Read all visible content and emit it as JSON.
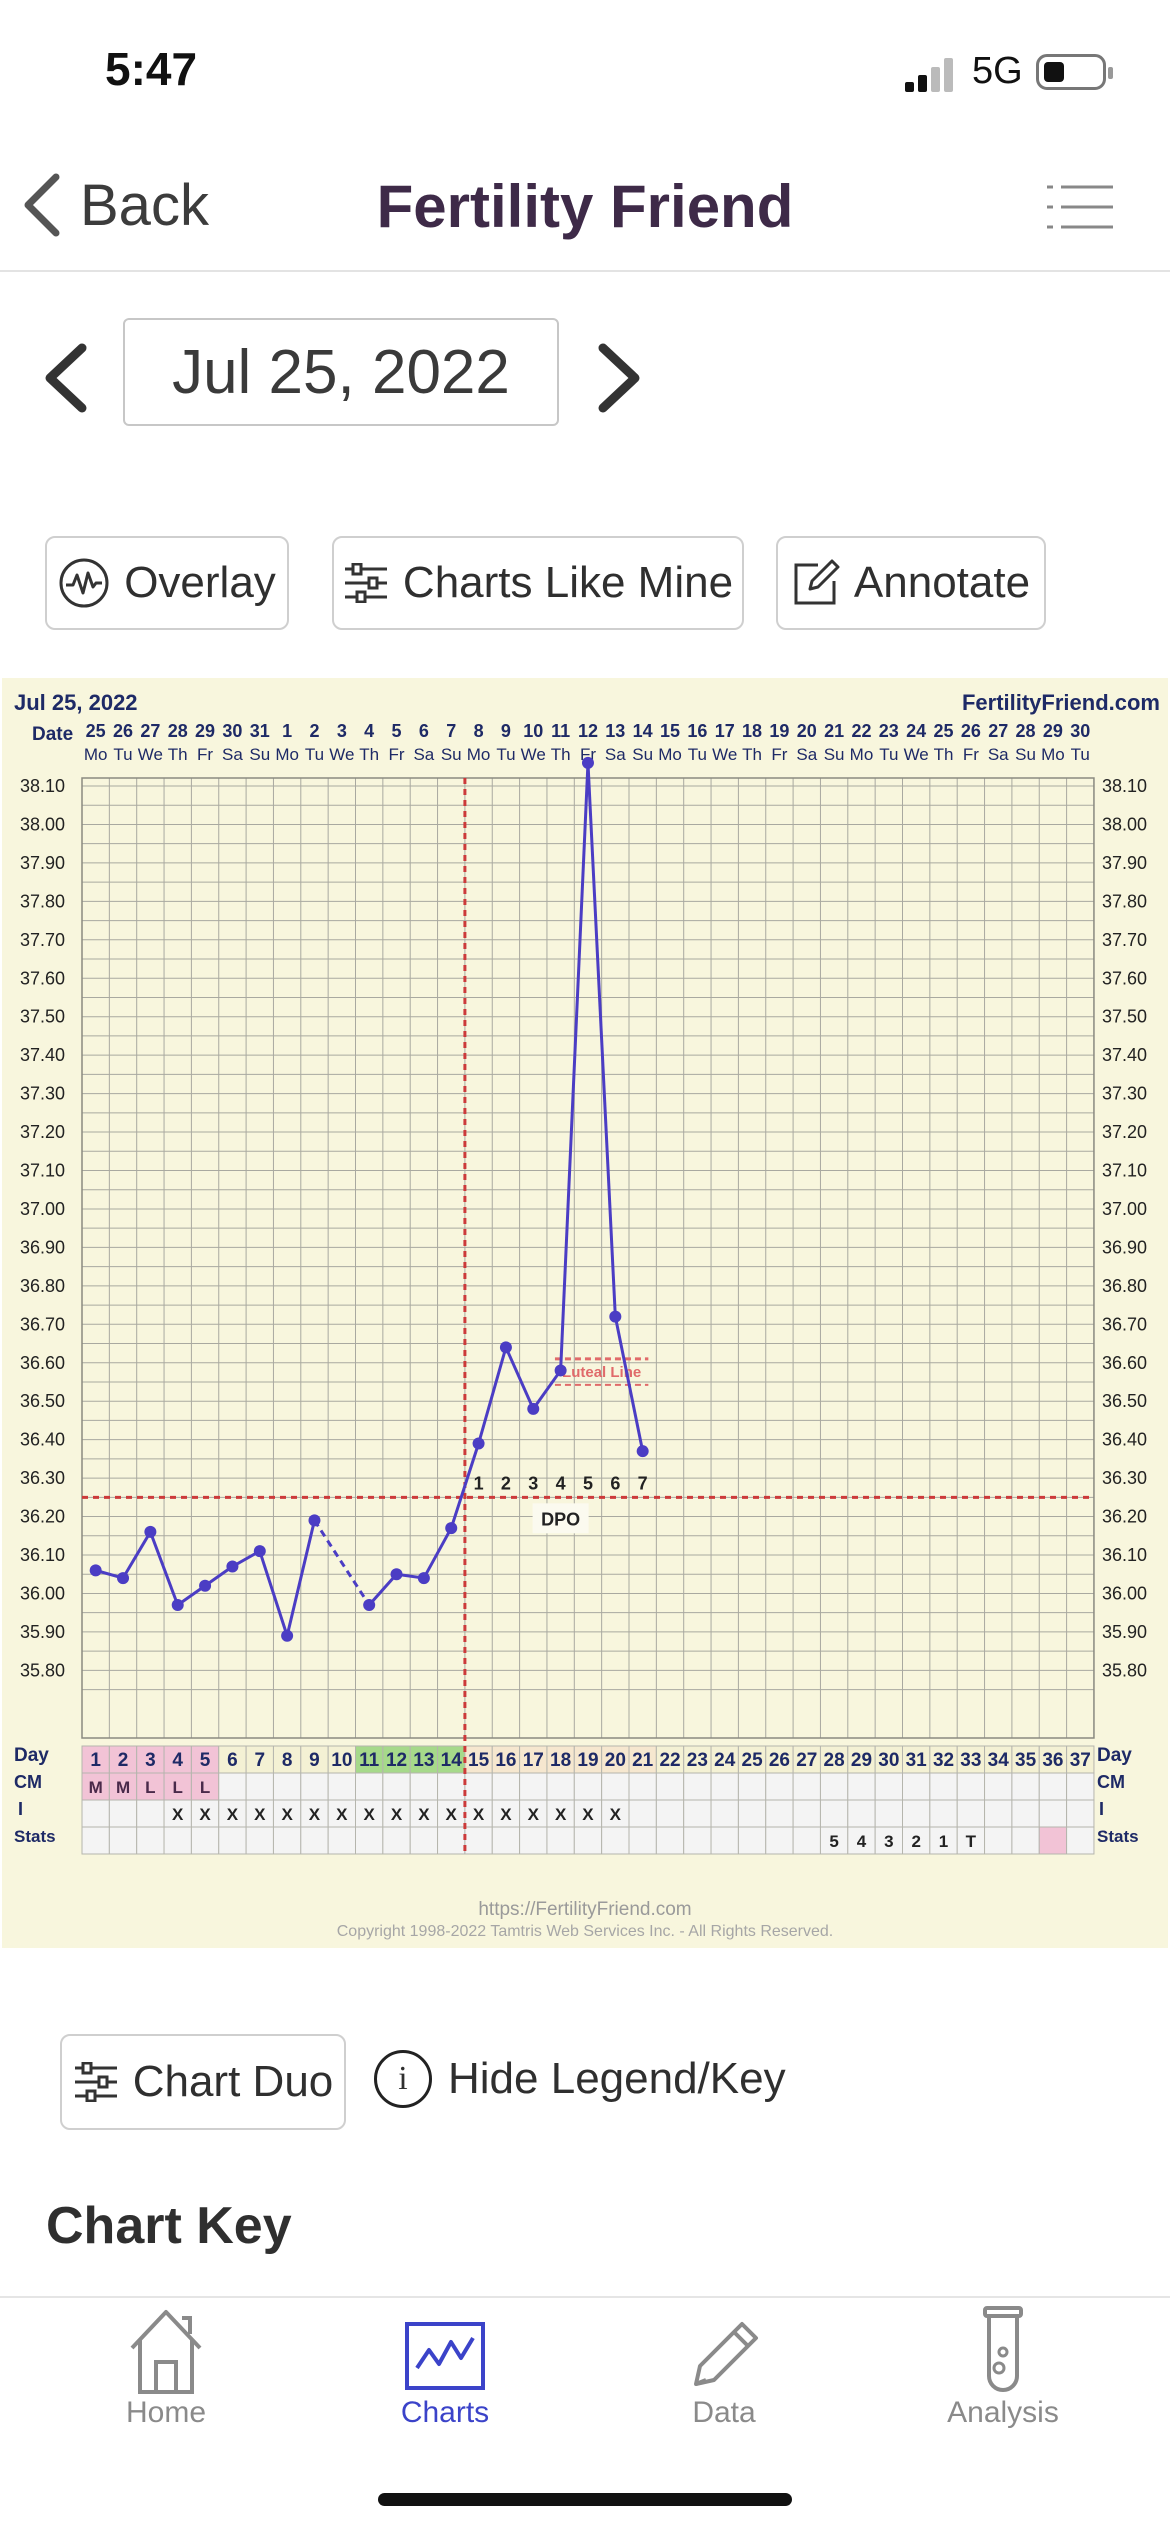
{
  "status": {
    "time": "5:47",
    "network": "5G"
  },
  "nav": {
    "back_label": "Back",
    "title": "Fertility Friend"
  },
  "date_picker": {
    "value": "Jul 25, 2022"
  },
  "actions": {
    "overlay": "Overlay",
    "charts_like_mine": "Charts Like Mine",
    "annotate": "Annotate"
  },
  "chart": {
    "date_label": "Jul 25, 2022",
    "brand": "FertilityFriend.com",
    "row_labels": {
      "date": "Date",
      "day": "Day",
      "cm": "CM",
      "i": "I",
      "stats": "Stats"
    },
    "footer_url": "https://FertilityFriend.com",
    "footer_copyright": "Copyright 1998-2022 Tamtris Web Services Inc. - All Rights Reserved.",
    "luteal_label": "Luteal Line",
    "dpo_label": "DPO"
  },
  "chart_data": {
    "type": "line",
    "title": "",
    "dates": [
      "25",
      "26",
      "27",
      "28",
      "29",
      "30",
      "31",
      "1",
      "2",
      "3",
      "4",
      "5",
      "6",
      "7",
      "8",
      "9",
      "10",
      "11",
      "12",
      "13",
      "14",
      "15",
      "16",
      "17",
      "18",
      "19",
      "20",
      "21",
      "22",
      "23",
      "24",
      "25",
      "26",
      "27",
      "28",
      "29",
      "30"
    ],
    "weekdays": [
      "Mo",
      "Tu",
      "We",
      "Th",
      "Fr",
      "Sa",
      "Su",
      "Mo",
      "Tu",
      "We",
      "Th",
      "Fr",
      "Sa",
      "Su",
      "Mo",
      "Tu",
      "We",
      "Th",
      "Fr",
      "Sa",
      "Su",
      "Mo",
      "Tu",
      "We",
      "Th",
      "Fr",
      "Sa",
      "Su",
      "Mo",
      "Tu",
      "We",
      "Th",
      "Fr",
      "Sa",
      "Su",
      "Mo",
      "Tu"
    ],
    "cycle_days": [
      1,
      2,
      3,
      4,
      5,
      6,
      7,
      8,
      9,
      10,
      11,
      12,
      13,
      14,
      15,
      16,
      17,
      18,
      19,
      20,
      21,
      22,
      23,
      24,
      25,
      26,
      27,
      28,
      29,
      30,
      31,
      32,
      33,
      34,
      35,
      36,
      37
    ],
    "y_ticks": [
      "38.10",
      "38.00",
      "37.90",
      "37.80",
      "37.70",
      "37.60",
      "37.50",
      "37.40",
      "37.30",
      "37.20",
      "37.10",
      "37.00",
      "36.90",
      "36.80",
      "36.70",
      "36.60",
      "36.50",
      "36.40",
      "36.30",
      "36.20",
      "36.10",
      "36.00",
      "35.90",
      "35.80"
    ],
    "ylim": [
      35.75,
      38.15
    ],
    "series": [
      {
        "values": [
          36.06,
          36.04,
          36.16,
          35.97,
          36.02,
          36.07,
          36.11,
          35.89,
          36.19,
          null,
          35.97,
          36.05,
          36.04,
          36.17,
          36.39,
          36.64,
          36.48,
          36.58,
          38.16,
          36.72,
          36.37
        ]
      }
    ],
    "dashed_segments": [
      [
        9,
        11
      ]
    ],
    "coverline": 36.25,
    "ovulation_day": 14,
    "dpo_labels": [
      "1",
      "2",
      "3",
      "4",
      "5",
      "6",
      "7"
    ],
    "luteal_line": {
      "value": 36.61,
      "from_day": 18,
      "to_day": 21
    },
    "cm": [
      "M",
      "M",
      "L",
      "L",
      "L"
    ],
    "i_marks_days": [
      4,
      5,
      6,
      7,
      8,
      9,
      10,
      11,
      12,
      13,
      14,
      15,
      16,
      17,
      18,
      19,
      20
    ],
    "green_days": [
      11,
      12,
      13,
      14
    ],
    "stats": [
      {
        "day": 28,
        "text": "5"
      },
      {
        "day": 29,
        "text": "4"
      },
      {
        "day": 30,
        "text": "3"
      },
      {
        "day": 31,
        "text": "2"
      },
      {
        "day": 32,
        "text": "1"
      },
      {
        "day": 33,
        "text": "T"
      }
    ],
    "stats_pink_day": 36,
    "colors": {
      "line": "#4b3dc4",
      "coverline": "#cc3a3a",
      "luteal": "#e06a6a",
      "grid": "#a9a9a0",
      "period": "#f2c3d6",
      "fertile": "#a6d98a"
    }
  },
  "legend": {
    "chart_duo": "Chart Duo",
    "hide_legend": "Hide Legend/Key",
    "chart_key": "Chart Key"
  },
  "tabs": [
    {
      "label": "Home",
      "icon": "home-icon"
    },
    {
      "label": "Charts",
      "icon": "chart-icon",
      "active": true
    },
    {
      "label": "Data",
      "icon": "pencil-icon"
    },
    {
      "label": "Analysis",
      "icon": "test-tube-icon"
    }
  ]
}
